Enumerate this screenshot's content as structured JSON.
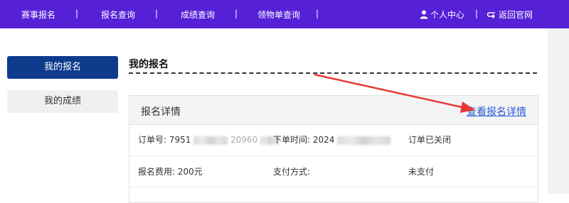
{
  "nav": {
    "items": [
      {
        "label": "赛事报名"
      },
      {
        "label": "报名查询"
      },
      {
        "label": "成绩查询"
      },
      {
        "label": "领物单查询"
      }
    ],
    "separator": "|",
    "user_center": "个人中心",
    "return_site": "返回官网"
  },
  "sidebar": {
    "items": [
      {
        "label": "我的报名",
        "active": true
      },
      {
        "label": "我的成绩",
        "active": false
      }
    ]
  },
  "main": {
    "title": "我的报名",
    "card": {
      "title": "报名详情",
      "link": "查看报名详情",
      "order_no_label": "订单号:",
      "order_no_visible": "7951",
      "order_no_tail": "20960",
      "order_time_label": "下单时间:",
      "order_time_visible": "2024",
      "order_status": "订单已关闭",
      "fee_label": "报名费用:",
      "fee_value": "200元",
      "pay_method_label": "支付方式:",
      "pay_status": "未支付"
    }
  },
  "colors": {
    "topbar": "#5520d6",
    "active_sidebar": "#0e3b8c",
    "link": "#2a5bd7",
    "annotation_arrow": "#e53935"
  }
}
